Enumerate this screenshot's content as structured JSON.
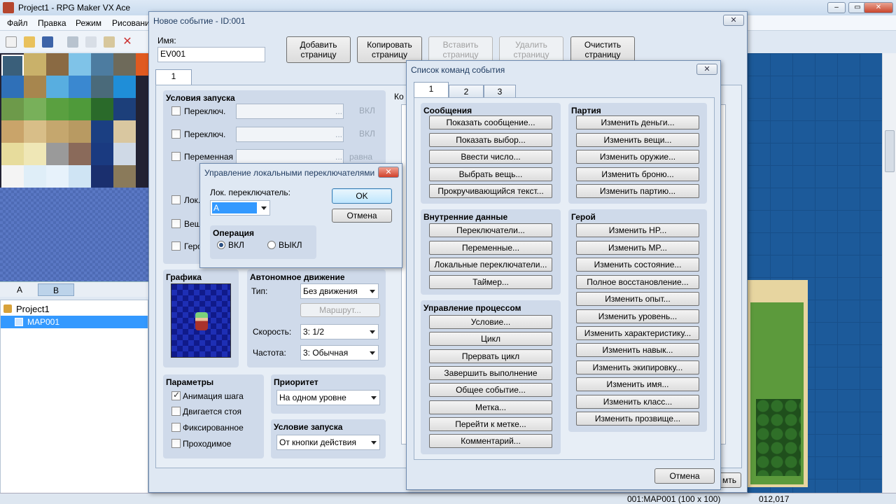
{
  "app": {
    "title": "Project1 - RPG Maker VX Ace",
    "menus": [
      "Файл",
      "Правка",
      "Режим",
      "Рисовани"
    ],
    "min": "–",
    "max": "▭",
    "close": "✕"
  },
  "tiles": {
    "tabs": [
      "A",
      "B"
    ]
  },
  "tree": {
    "project": "Project1",
    "map": "MAP001"
  },
  "status": {
    "mapinfo": "001:MAP001 (100 x 100)",
    "coords": "012,017"
  },
  "event": {
    "title": "Новое событие - ID:001",
    "name_label": "Имя:",
    "name_value": "EV001",
    "buttons": {
      "add": "Добавить страницу",
      "copy": "Копировать страницу",
      "paste": "Вставить страницу",
      "delete": "Удалить страницу",
      "clear": "Очистить страницу"
    },
    "page_tab": "1",
    "conditions": {
      "title": "Условия запуска",
      "switch1": "Переключ.",
      "switch2": "Переключ.",
      "variable": "Переменная",
      "local": "Лок.",
      "item": "Вещ",
      "hero": "Геро",
      "dots": "...",
      "on1": "ВКЛ",
      "on2": "ВКЛ",
      "eq": "равна"
    },
    "graphics_title": "Графика",
    "autonomous": {
      "title": "Автономное движение",
      "type_label": "Тип:",
      "type_value": "Без движения",
      "route": "Маршрут...",
      "speed_label": "Скорость:",
      "speed_value": "3: 1/2",
      "freq_label": "Частота:",
      "freq_value": "3: Обычная"
    },
    "params": {
      "title": "Параметры",
      "walk": "Анимация шага",
      "step": "Двигается стоя",
      "fixed": "Фиксированное",
      "through": "Проходимое"
    },
    "priority": {
      "title": "Приоритет",
      "value": "На одном уровне"
    },
    "trigger": {
      "title": "Условие запуска",
      "value": "От кнопки действия"
    },
    "code_label": "Ко",
    "ok_partial": "мть"
  },
  "local_switch": {
    "title": "Управление локальными переключателями",
    "switch_label": "Лок. переключатель:",
    "switch_value": "A",
    "ok": "OK",
    "cancel": "Отмена",
    "op_title": "Операция",
    "on": "ВКЛ",
    "off": "ВЫКЛ"
  },
  "commands": {
    "title": "Список команд события",
    "tabs": [
      "1",
      "2",
      "3"
    ],
    "messages": {
      "title": "Сообщения",
      "items": [
        "Показать сообщение...",
        "Показать выбор...",
        "Ввести число...",
        "Выбрать вещь...",
        "Прокручивающийся текст..."
      ]
    },
    "party": {
      "title": "Партия",
      "items": [
        "Изменить деньги...",
        "Изменить вещи...",
        "Изменить оружие...",
        "Изменить броню...",
        "Изменить партию..."
      ]
    },
    "internal": {
      "title": "Внутренние данные",
      "items": [
        "Переключатели...",
        "Переменные...",
        "Локальные переключатели...",
        "Таймер..."
      ]
    },
    "hero": {
      "title": "Герой",
      "items": [
        "Изменить HP...",
        "Изменить MP...",
        "Изменить состояние...",
        "Полное восстановление...",
        "Изменить опыт...",
        "Изменить уровень...",
        "Изменить характеристику...",
        "Изменить навык...",
        "Изменить экипировку...",
        "Изменить имя...",
        "Изменить класс...",
        "Изменить прозвище..."
      ]
    },
    "flow": {
      "title": "Управление процессом",
      "items": [
        "Условие...",
        "Цикл",
        "Прервать цикл",
        "Завершить выполнение",
        "Общее событие...",
        "Метка...",
        "Перейти к метке...",
        "Комментарий..."
      ]
    },
    "cancel": "Отмена"
  }
}
